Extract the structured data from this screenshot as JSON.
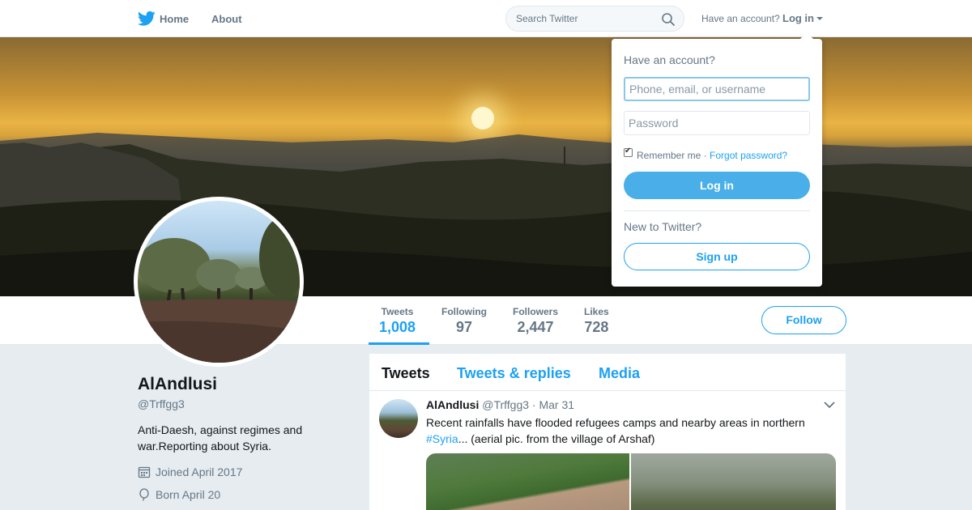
{
  "topbar": {
    "home_label": "Home",
    "about_label": "About",
    "search_placeholder": "Search Twitter",
    "have_account_label": "Have an account?",
    "login_label": "Log in"
  },
  "login_dropdown": {
    "title": "Have an account?",
    "username_placeholder": "Phone, email, or username",
    "password_placeholder": "Password",
    "remember_me_label": "Remember me",
    "separator": "·",
    "forgot_password_label": "Forgot password?",
    "remember_me_checked": true,
    "login_button_label": "Log in",
    "new_to_twitter_label": "New to Twitter?",
    "signup_button_label": "Sign up"
  },
  "profile": {
    "name": "AlAndlusi",
    "handle": "@Trffgg3",
    "bio": "Anti-Daesh, against regimes and war.Reporting about Syria.",
    "joined": "Joined April 2017",
    "born": "Born April 20"
  },
  "stats": [
    {
      "label": "Tweets",
      "value": "1,008",
      "active": true
    },
    {
      "label": "Following",
      "value": "97",
      "active": false
    },
    {
      "label": "Followers",
      "value": "2,447",
      "active": false
    },
    {
      "label": "Likes",
      "value": "728",
      "active": false
    }
  ],
  "follow_button_label": "Follow",
  "timeline": {
    "tabs": [
      {
        "label": "Tweets",
        "current": true
      },
      {
        "label": "Tweets & replies",
        "current": false
      },
      {
        "label": "Media",
        "current": false
      }
    ],
    "tweet": {
      "name": "AlAndlusi",
      "handle": "@Trffgg3",
      "dot": "·",
      "date": "Mar 31",
      "text_before": "Recent rainfalls have flooded refugees camps and nearby areas in northern",
      "hashtag": "#Syria",
      "text_after": "... (aerial pic. from the village of Arshaf)"
    }
  },
  "colors": {
    "accent": "#1da1f2",
    "secondary_text": "#657786",
    "background": "#e6ecf0"
  },
  "icons": {
    "logo": "twitter-bird-icon",
    "search": "search-icon",
    "calendar": "calendar-icon",
    "balloon": "balloon-icon",
    "chevron": "chevron-down-icon"
  }
}
